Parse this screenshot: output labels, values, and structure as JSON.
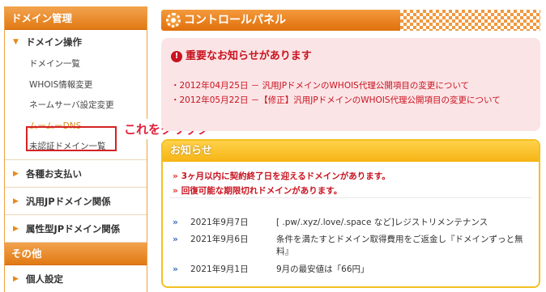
{
  "sidebar": {
    "domain_section": "ドメイン管理",
    "domain_ops": "ドメイン操作",
    "sub_items": [
      "ドメイン一覧",
      "WHOIS情報変更",
      "ネームサーバ設定変更",
      "ムームーDNS",
      "未認証ドメイン一覧"
    ],
    "groups": [
      "各種お支払い",
      "汎用JPドメイン関係",
      "属性型JPドメイン関係"
    ],
    "other_section": "その他",
    "personal": "個人設定"
  },
  "callout": "これをクリック",
  "main": {
    "title": "コントロールパネル",
    "notice_title": "重要なお知らせがあります",
    "notice_items": [
      "・2012年04月25日 － 汎用JPドメインのWHOIS代理公開項目の変更について",
      "・2012年05月22日 －【修正】汎用JPドメインのWHOIS代理公開項目の変更について"
    ],
    "oshirase_title": "お知らせ",
    "alerts": [
      "3ヶ月以内に契約終了日を迎えるドメインがあります。",
      "回復可能な期限切れドメインがあります。"
    ],
    "news": [
      {
        "date": "2021年9月7日",
        "text": "[ .pw/.xyz/.love/.space など]レジストリメンテナンス"
      },
      {
        "date": "2021年9月6日",
        "text": "条件を満たすとドメイン取得費用をご返金し『ドメインずっと無料』"
      },
      {
        "date": "2021年9月1日",
        "text": "9月の最安値は「66円」"
      }
    ]
  },
  "colors": {
    "accent": "#e17a14",
    "alert": "#c8131f",
    "highlight": "#d42222"
  }
}
